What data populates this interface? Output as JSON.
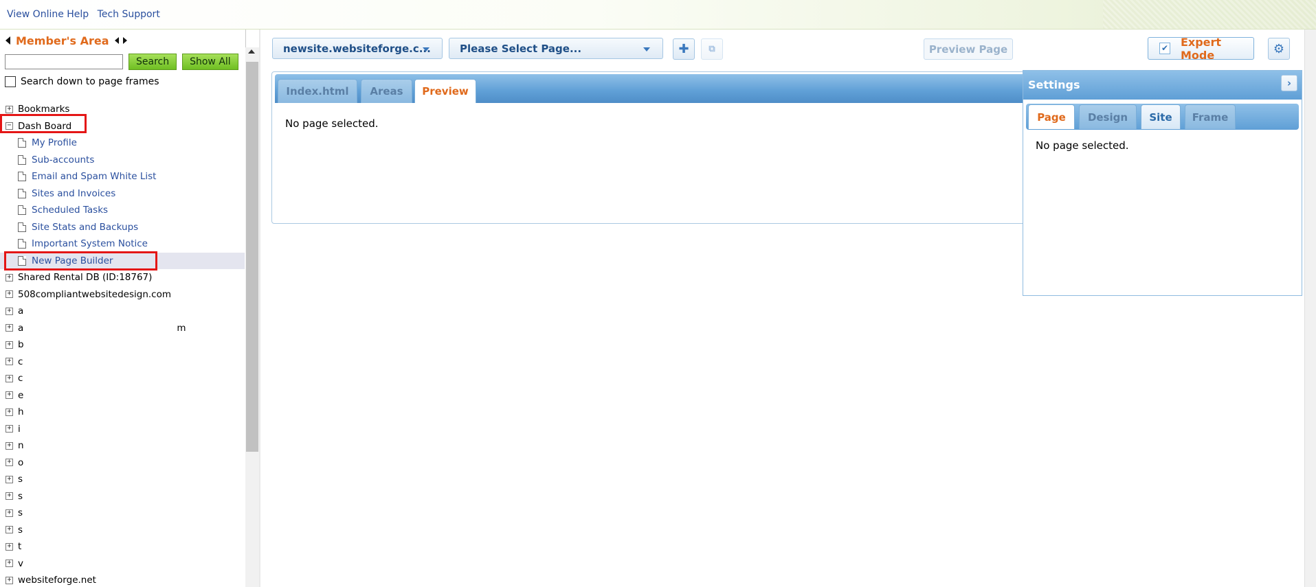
{
  "topbar": {
    "links": [
      "View Online Help",
      "Tech Support"
    ]
  },
  "sidebar": {
    "title": "Member's Area",
    "search_placeholder": "",
    "search_button": "Search",
    "show_all_button": "Show All",
    "search_frames_label": "Search down to page frames",
    "tree": [
      {
        "label": "Bookmarks",
        "type": "folder",
        "expanded": false
      },
      {
        "label": "Dash Board",
        "type": "folder",
        "expanded": true
      },
      {
        "label": "My Profile",
        "type": "page"
      },
      {
        "label": "Sub-accounts",
        "type": "page"
      },
      {
        "label": "Email and Spam White List",
        "type": "page"
      },
      {
        "label": "Sites and Invoices",
        "type": "page"
      },
      {
        "label": "Scheduled Tasks",
        "type": "page"
      },
      {
        "label": "Site Stats and Backups",
        "type": "page"
      },
      {
        "label": "Important System Notice",
        "type": "page"
      },
      {
        "label": "New Page Builder",
        "type": "page",
        "selected": true
      },
      {
        "label": "Shared Rental DB (ID:18767)",
        "type": "folder",
        "expanded": false
      },
      {
        "label": "508compliantwebsitedesign.com",
        "type": "folder",
        "expanded": false
      },
      {
        "label": "a",
        "type": "folder",
        "expanded": false
      },
      {
        "label": "a                                                    m",
        "type": "folder",
        "expanded": false
      },
      {
        "label": "b",
        "type": "folder",
        "expanded": false
      },
      {
        "label": "c",
        "type": "folder",
        "expanded": false
      },
      {
        "label": "c",
        "type": "folder",
        "expanded": false
      },
      {
        "label": "e",
        "type": "folder",
        "expanded": false
      },
      {
        "label": "h",
        "type": "folder",
        "expanded": false
      },
      {
        "label": "i",
        "type": "folder",
        "expanded": false
      },
      {
        "label": "n",
        "type": "folder",
        "expanded": false
      },
      {
        "label": "o",
        "type": "folder",
        "expanded": false
      },
      {
        "label": "s",
        "type": "folder",
        "expanded": false
      },
      {
        "label": "s",
        "type": "folder",
        "expanded": false
      },
      {
        "label": "s",
        "type": "folder",
        "expanded": false
      },
      {
        "label": "s",
        "type": "folder",
        "expanded": false
      },
      {
        "label": "t",
        "type": "folder",
        "expanded": false
      },
      {
        "label": "v",
        "type": "folder",
        "expanded": false
      },
      {
        "label": "websiteforge.net",
        "type": "folder",
        "expanded": false
      }
    ]
  },
  "toolbar": {
    "site_select": "newsite.websiteforge.c...",
    "page_select": "Please Select Page...",
    "add_icon": "plus-icon",
    "copy_icon": "copy-icon",
    "preview_button": "Preview Page",
    "expert_mode_button": "Expert Mode",
    "gear_icon": "gear-icon"
  },
  "editor": {
    "tabs": [
      "Index.html",
      "Areas",
      "Preview"
    ],
    "active_tab": "Preview",
    "message": "No page selected."
  },
  "settings": {
    "title": "Settings",
    "tabs": [
      "Page",
      "Design",
      "Site",
      "Frame"
    ],
    "active_tab": "Page",
    "message": "No page selected."
  },
  "colors": {
    "accent_orange": "#e06a1c",
    "link_blue": "#2a4f9e",
    "tab_blue": "#5f9fd6",
    "highlight_red": "#e41616"
  }
}
